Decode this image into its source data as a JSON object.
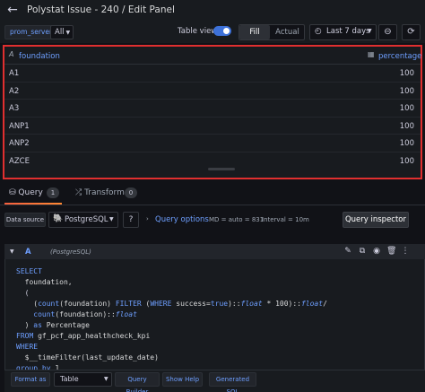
{
  "header": {
    "title": "Polystat Issue - 240 / Edit Panel"
  },
  "toolbar": {
    "variable_label": "prom_server",
    "variable_value": "All",
    "table_view_label": "Table view",
    "fill_label": "Fill",
    "actual_label": "Actual",
    "time_range": "Last 7 days"
  },
  "table": {
    "columns": [
      "foundation",
      "percentage"
    ],
    "column_type_icons": [
      "A",
      "▦"
    ],
    "rows": [
      [
        "A1",
        "100"
      ],
      [
        "A2",
        "100"
      ],
      [
        "A3",
        "100"
      ],
      [
        "ANP1",
        "100"
      ],
      [
        "ANP2",
        "100"
      ],
      [
        "AZCE",
        "100"
      ]
    ]
  },
  "tabs": [
    {
      "label": "Query",
      "count": "1"
    },
    {
      "label": "Transform",
      "count": "0"
    }
  ],
  "datasource": {
    "label": "Data source",
    "name": "PostgreSQL",
    "query_options_label": "Query options",
    "md_info": "MD = auto = 831",
    "interval_info": "Interval = 10m",
    "inspector_label": "Query inspector"
  },
  "query": {
    "ref": "A",
    "datasource_hint": "(PostgreSQL)"
  },
  "footer": {
    "format_label": "Format as",
    "format_value": "Table",
    "builder_label": "Query Builder",
    "help_label": "Show Help",
    "generated_label": "Generated SQL"
  },
  "icons": {
    "back": "arrow-left-icon",
    "clock": "clock-icon",
    "zoom_out": "zoom-out-icon",
    "refresh": "refresh-icon",
    "pg": "postgresql-icon"
  },
  "colors": {
    "accent_blue": "#6e9fff",
    "highlight_red": "#e02f2f",
    "toggle_blue": "#3d71d9",
    "tab_orange": "#f55f3e"
  }
}
